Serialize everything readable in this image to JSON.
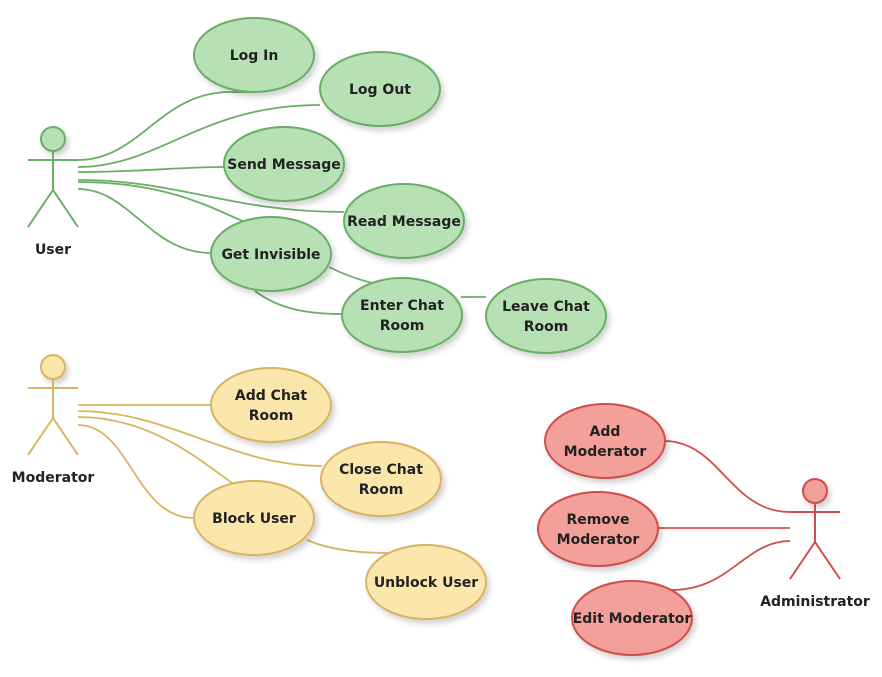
{
  "diagram": {
    "type": "use-case",
    "colors": {
      "user": {
        "fill": "#b7e1b5",
        "stroke": "#6aae66"
      },
      "moderator": {
        "fill": "#fbe6ac",
        "stroke": "#d8b460"
      },
      "administrator": {
        "fill": "#f4a09a",
        "stroke": "#cf4e4b"
      }
    },
    "actors": [
      {
        "id": "user",
        "label": "User"
      },
      {
        "id": "moderator",
        "label": "Moderator"
      },
      {
        "id": "administrator",
        "label": "Administrator"
      }
    ],
    "use_cases": [
      {
        "id": "log-in",
        "lines": [
          "Log In"
        ],
        "group": "user"
      },
      {
        "id": "log-out",
        "lines": [
          "Log Out"
        ],
        "group": "user"
      },
      {
        "id": "send-message",
        "lines": [
          "Send Message"
        ],
        "group": "user"
      },
      {
        "id": "read-message",
        "lines": [
          "Read Message"
        ],
        "group": "user"
      },
      {
        "id": "get-invisible",
        "lines": [
          "Get Invisible"
        ],
        "group": "user"
      },
      {
        "id": "enter-chat-room",
        "lines": [
          "Enter Chat",
          "Room"
        ],
        "group": "user"
      },
      {
        "id": "leave-chat-room",
        "lines": [
          "Leave Chat",
          "Room"
        ],
        "group": "user"
      },
      {
        "id": "add-chat-room",
        "lines": [
          "Add Chat",
          "Room"
        ],
        "group": "moderator"
      },
      {
        "id": "close-chat-room",
        "lines": [
          "Close Chat",
          "Room"
        ],
        "group": "moderator"
      },
      {
        "id": "block-user",
        "lines": [
          "Block User"
        ],
        "group": "moderator"
      },
      {
        "id": "unblock-user",
        "lines": [
          "Unblock User"
        ],
        "group": "moderator"
      },
      {
        "id": "add-moderator",
        "lines": [
          "Add",
          "Moderator"
        ],
        "group": "administrator"
      },
      {
        "id": "remove-moderator",
        "lines": [
          "Remove",
          "Moderator"
        ],
        "group": "administrator"
      },
      {
        "id": "edit-moderator",
        "lines": [
          "Edit Moderator"
        ],
        "group": "administrator"
      }
    ],
    "associations": [
      [
        "user",
        "log-in"
      ],
      [
        "user",
        "log-out"
      ],
      [
        "user",
        "send-message"
      ],
      [
        "user",
        "read-message"
      ],
      [
        "user",
        "get-invisible"
      ],
      [
        "user",
        "enter-chat-room"
      ],
      [
        "get-invisible",
        "enter-chat-room"
      ],
      [
        "enter-chat-room",
        "leave-chat-room"
      ],
      [
        "moderator",
        "add-chat-room"
      ],
      [
        "moderator",
        "close-chat-room"
      ],
      [
        "moderator",
        "block-user"
      ],
      [
        "block-user",
        "unblock-user"
      ],
      [
        "administrator",
        "add-moderator"
      ],
      [
        "administrator",
        "remove-moderator"
      ],
      [
        "administrator",
        "edit-moderator"
      ]
    ]
  }
}
